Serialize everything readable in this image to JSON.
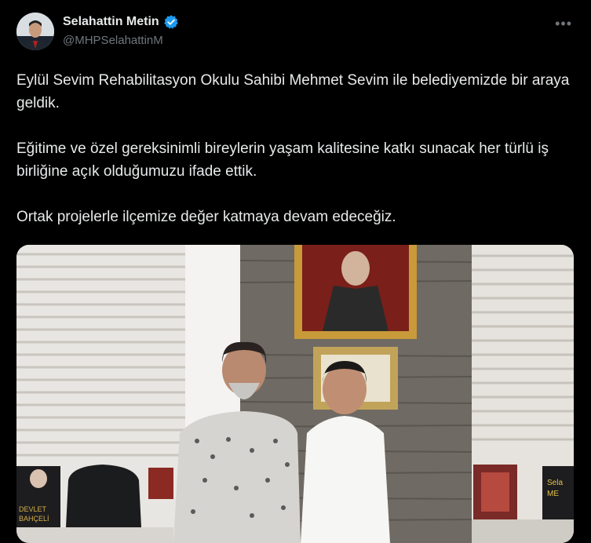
{
  "author": {
    "display_name": "Selahattin Metin",
    "handle": "@MHPSelahattinM",
    "verified": true,
    "verified_color": "#1d9bf0"
  },
  "menu": {
    "more_label": "•••"
  },
  "tweet": {
    "paragraphs": [
      "Eylül Sevim Rehabilitasyon Okulu Sahibi Mehmet Sevim ile belediyemizde bir araya geldik.",
      "Eğitime ve özel gereksinimli bireylerin yaşam kalitesine katkı sunacak her türlü iş birliğine açık olduğumuzu ifade ettik.",
      "Ortak projelerle ilçemize değer katmaya devam edeceğiz."
    ]
  },
  "media": {
    "alt": "photo",
    "book_cover_text": [
      "DEVLET",
      "BAHÇELİ"
    ],
    "shelf_sign_text": [
      "Sela",
      "ME"
    ]
  },
  "colors": {
    "background": "#000000",
    "text": "#e7e9ea",
    "secondary": "#71767b"
  }
}
